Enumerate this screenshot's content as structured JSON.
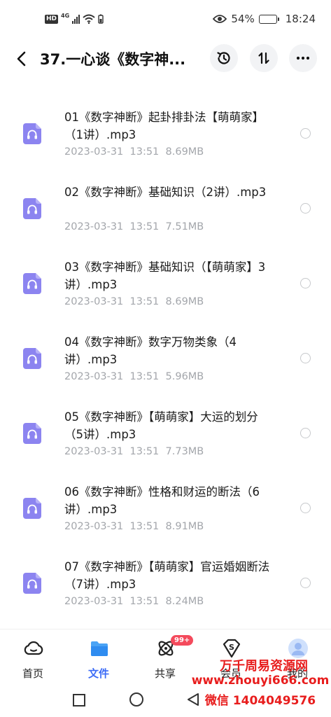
{
  "status_bar": {
    "hd": "HD",
    "network": "4G",
    "battery_percent": "54%",
    "battery_level": 0.54,
    "time": "18:24"
  },
  "header": {
    "title": "37.一心谈《数字神...",
    "icons": [
      "back-arrow-icon",
      "history-icon",
      "sort-icon",
      "more-icon"
    ]
  },
  "files": [
    {
      "name": "01《数字神断》起卦排卦法【萌萌家】（1讲）.mp3",
      "date": "2023-03-31",
      "time": "13:51",
      "size": "8.69MB"
    },
    {
      "name": "02《数字神断》基础知识（2讲）.mp3",
      "date": "2023-03-31",
      "time": "13:51",
      "size": "7.51MB"
    },
    {
      "name": "03《数字神断》基础知识（【萌萌家】3讲）.mp3",
      "date": "2023-03-31",
      "time": "13:51",
      "size": "8.69MB"
    },
    {
      "name": "04《数字神断》数字万物类象（4讲）.mp3",
      "date": "2023-03-31",
      "time": "13:51",
      "size": "5.96MB"
    },
    {
      "name": "05《数字神断》【萌萌家】大运的划分（5讲）.mp3",
      "date": "2023-03-31",
      "time": "13:51",
      "size": "7.73MB"
    },
    {
      "name": "06《数字神断》性格和财运的断法（6讲）.mp3",
      "date": "2023-03-31",
      "time": "13:51",
      "size": "8.91MB"
    },
    {
      "name": "07《数字神断》【萌萌家】官运婚姻断法（7讲）.mp3",
      "date": "2023-03-31",
      "time": "13:51",
      "size": "8.24MB"
    }
  ],
  "bottom_nav": {
    "home": "首页",
    "files": "文件",
    "share": "共享",
    "share_badge": "99+",
    "vip": "会员",
    "me": "我的"
  },
  "watermark": {
    "line1": "万千周易资源网",
    "line2": "www.zhouyi666.com",
    "line3": "微信 1404049576"
  },
  "colors": {
    "accent": "#3b6bf6",
    "file_icon": "#8c84f0",
    "badge": "#f44a5c",
    "meta_text": "#a3a6ab",
    "watermark": "#e81d1d"
  }
}
